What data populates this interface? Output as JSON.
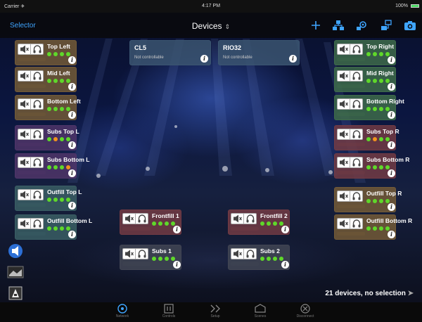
{
  "status_bar": {
    "carrier": "Carrier ✈",
    "time": "4:17 PM",
    "battery": "100%"
  },
  "nav": {
    "selector_label": "Selector",
    "title": "Devices",
    "title_chevron": "⇕"
  },
  "colors": {
    "accent": "#3fa5ff",
    "led_green": "#5fd82a",
    "led_orange": "#f2921d",
    "theme_brown": "#735b37",
    "theme_green": "#3e6b4a",
    "theme_red": "#723b44",
    "theme_purple": "#4f3569",
    "theme_teal": "#3a5e64",
    "theme_dark": "#414553",
    "theme_slate": "#3b5571"
  },
  "cards": [
    {
      "name": "Top Left",
      "leds": [
        "green",
        "green",
        "green",
        "green"
      ],
      "theme": "brown"
    },
    {
      "name": "Mid Left",
      "leds": [
        "green",
        "green",
        "green",
        "green"
      ],
      "theme": "brown"
    },
    {
      "name": "Bottom Left",
      "leds": [
        "green",
        "green",
        "green",
        "green"
      ],
      "theme": "brown"
    },
    {
      "name": "Subs Top L",
      "leds": [
        "green",
        "orange",
        "green",
        "green"
      ],
      "theme": "purple"
    },
    {
      "name": "Subs Bottom L",
      "leds": [
        "green",
        "green",
        "green",
        "orange"
      ],
      "theme": "purple"
    },
    {
      "name": "Outfill Top L",
      "leds": [
        "green",
        "green",
        "green",
        "green"
      ],
      "theme": "teal"
    },
    {
      "name": "Outfill Bottom L",
      "leds": [
        "green",
        "green",
        "green",
        "green"
      ],
      "theme": "teal"
    },
    {
      "name": "Frontfill 1",
      "leds": [
        "green",
        "green",
        "green",
        "green"
      ],
      "theme": "red"
    },
    {
      "name": "Frontfill 2",
      "leds": [
        "green",
        "green",
        "green",
        "green"
      ],
      "theme": "red"
    },
    {
      "name": "Subs 1",
      "leds": [
        "green",
        "green",
        "green",
        "green"
      ],
      "theme": "dark"
    },
    {
      "name": "Subs 2",
      "leds": [
        "green",
        "green",
        "green",
        "green"
      ],
      "theme": "dark"
    },
    {
      "name": "Top Right",
      "leds": [
        "green",
        "green",
        "green",
        "green"
      ],
      "theme": "green"
    },
    {
      "name": "Mid Right",
      "leds": [
        "green",
        "green",
        "green",
        "green"
      ],
      "theme": "green"
    },
    {
      "name": "Bottom Right",
      "leds": [
        "green",
        "green",
        "green",
        "green"
      ],
      "theme": "green"
    },
    {
      "name": "Subs Top R",
      "leds": [
        "green",
        "orange",
        "green",
        "green"
      ],
      "theme": "red"
    },
    {
      "name": "Subs Bottom R",
      "leds": [
        "green",
        "green",
        "green",
        "green"
      ],
      "theme": "red"
    },
    {
      "name": "Outfill Top R",
      "leds": [
        "green",
        "green",
        "green",
        "green"
      ],
      "theme": "brown"
    },
    {
      "name": "Outfill Bottom R",
      "leds": [
        "green",
        "green",
        "green",
        "green"
      ],
      "theme": "brown"
    }
  ],
  "hardware": [
    {
      "name": "CL5",
      "status": "Not controllable"
    },
    {
      "name": "RIO32",
      "status": "Not controllable"
    }
  ],
  "footer": {
    "device_count": "21 devices, no selection"
  },
  "tabs": [
    {
      "label": "Network",
      "icon": "network-icon",
      "active": true
    },
    {
      "label": "Controls",
      "icon": "controls-icon",
      "active": false
    },
    {
      "label": "Setup",
      "icon": "setup-icon",
      "active": false
    },
    {
      "label": "Scenes",
      "icon": "scenes-icon",
      "active": false
    },
    {
      "label": "Disconnect",
      "icon": "disconnect-icon",
      "active": false
    }
  ]
}
